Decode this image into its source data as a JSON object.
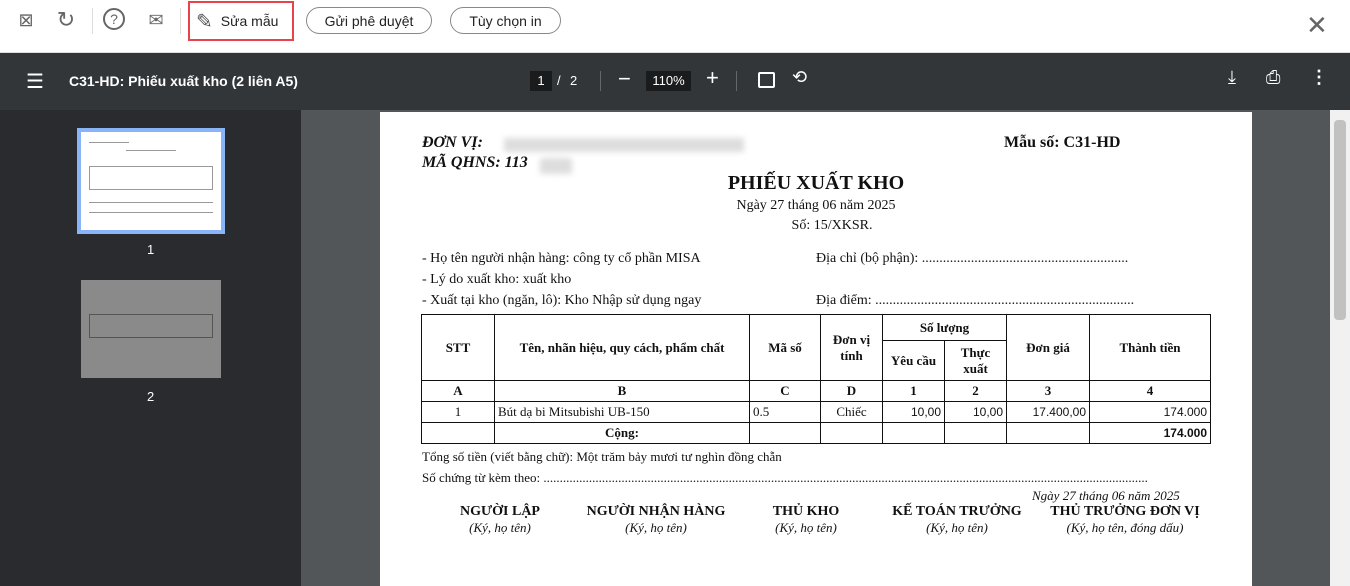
{
  "toolbar": {
    "edit_label": "Sửa mẫu",
    "approve_label": "Gửi phê duyệt",
    "print_options_label": "Tùy chọn in"
  },
  "viewer": {
    "title": "C31-HD: Phiếu xuất kho (2 liên A5)",
    "page_current": "1",
    "page_sep": "/",
    "page_total": "2",
    "zoom": "110%",
    "thumbnails": [
      "1",
      "2"
    ]
  },
  "doc": {
    "unit_label": "ĐƠN VỊ:",
    "qhns_label": "MÃ QHNS: 113",
    "form_no": "Mẫu số: C31-HD",
    "title": "PHIẾU XUẤT KHO",
    "date": "Ngày 27 tháng 06 năm 2025",
    "number": "Số: 15/XKSR.",
    "receiver": "- Họ tên người nhận hàng: công ty cổ phần MISA",
    "address": "Địa chỉ (bộ phận): ...........................................................",
    "reason": "- Lý do xuất kho: xuất kho",
    "warehouse": "- Xuất tại kho (ngăn, lô): Kho Nhập sử dụng ngay",
    "location": "Địa điểm: ..........................................................................",
    "headers": {
      "stt": "STT",
      "name": "Tên, nhãn hiệu, quy cách, phẩm chất",
      "code": "Mã số",
      "unit": "Đơn vị tính",
      "qty": "Số lượng",
      "req": "Yêu cầu",
      "actual": "Thực xuất",
      "price": "Đơn giá",
      "amount": "Thành tiền"
    },
    "letters": [
      "A",
      "B",
      "C",
      "D",
      "1",
      "2",
      "3",
      "4"
    ],
    "rows": [
      {
        "stt": "1",
        "name": "Bút dạ bi Mitsubishi UB-150",
        "code": "0.5",
        "unit": "Chiếc",
        "req": "10,00",
        "actual": "10,00",
        "price": "17.400,00",
        "amount": "174.000"
      }
    ],
    "total_label": "Cộng:",
    "total": "174.000",
    "in_words": "Tổng số tiền (viết bằng chữ): Một trăm bảy mươi tư nghìn đồng chẵn",
    "attachments": "Số chứng từ kèm theo: ..........................................................................................................................................................................................",
    "sign_date": "Ngày 27 tháng 06 năm 2025",
    "signers": [
      {
        "title": "NGƯỜI LẬP",
        "note": "(Ký, họ tên)"
      },
      {
        "title": "NGƯỜI NHẬN HÀNG",
        "note": "(Ký, họ tên)"
      },
      {
        "title": "THỦ KHO",
        "note": "(Ký, họ tên)"
      },
      {
        "title": "KẾ TOÁN TRƯỞNG",
        "note": "(Ký, họ tên)"
      },
      {
        "title": "THỦ TRƯỞNG ĐƠN VỊ",
        "note": "(Ký, họ tên, đóng dấu)"
      }
    ]
  }
}
